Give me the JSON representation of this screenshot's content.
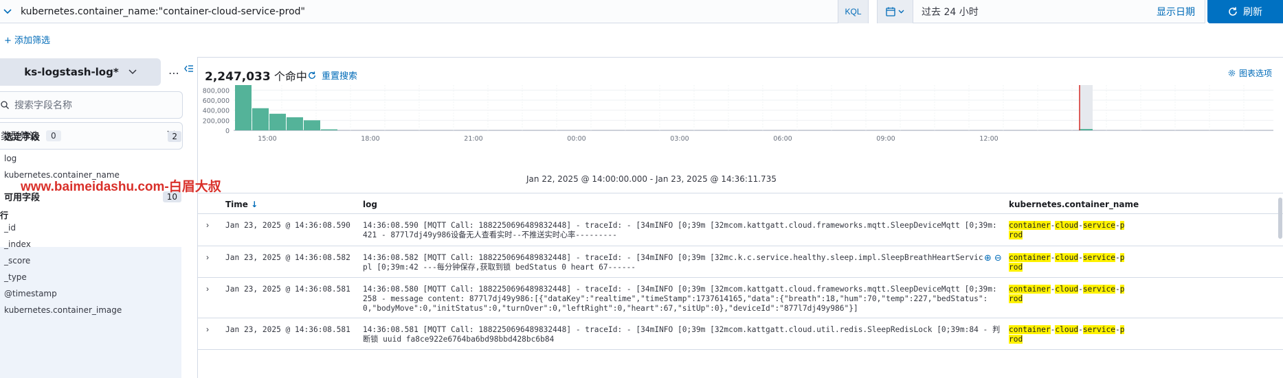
{
  "query": {
    "text": "kubernetes.container_name:\"container-cloud-service-prod\"",
    "language": "KQL"
  },
  "date_picker": {
    "range": "过去 24 小时",
    "show_dates": "显示日期"
  },
  "refresh_label": "刷新",
  "add_filter_label": "+ 添加筛选",
  "sidebar": {
    "index_pattern": "ks-logstash-log*",
    "search_placeholder": "搜索字段名称",
    "type_filter_label": "类型筛选",
    "type_filter_count": "0",
    "selected_fields_title": "选定字段",
    "selected_fields_count": "2",
    "selected_fields": [
      "log",
      "kubernetes.container_name"
    ],
    "available_fields_title": "可用字段",
    "available_fields_count": "10",
    "popular_label": "流行",
    "available_fields": [
      "_id",
      "_index",
      "_score",
      "_type",
      "@timestamp",
      "kubernetes.container_image"
    ]
  },
  "watermark": "www.baimeidashu.com-白眉大叔",
  "main": {
    "hits_count": "2,247,033",
    "hits_suffix": "个命中",
    "reset_search": "重置搜索",
    "chart_options": "图表选项",
    "time_range": "Jan 22, 2025 @ 14:00:00.000 - Jan 23, 2025 @ 14:36:11.735"
  },
  "chart_data": {
    "type": "bar",
    "y_ticks": [
      "800,000",
      "600,000",
      "400,000",
      "200,000",
      "0"
    ],
    "x_ticks": [
      "15:00",
      "18:00",
      "21:00",
      "00:00",
      "03:00",
      "06:00",
      "09:00",
      "12:00"
    ],
    "ylim": [
      0,
      900000
    ],
    "values": [
      980000,
      440000,
      330000,
      260000,
      200000,
      20000
    ],
    "color": "#54b399",
    "end_marker_color": "#d9302a"
  },
  "table": {
    "headers": {
      "time": "Time",
      "log": "log",
      "kube": "kubernetes.container_name"
    },
    "rows": [
      {
        "time": "Jan 23, 2025 @ 14:36:08.590",
        "log": "14:36:08.590 [MQTT Call: 1882250696489832448]  - traceId: -  [34mINFO  [0;39m  [32mcom.kattgatt.cloud.frameworks.mqtt.SleepDeviceMqtt [0;39m:421 - 877l7dj49y986设备无人查看实时--不推送实时心率---------",
        "kube": [
          "container",
          "-",
          "cloud",
          "-",
          "service",
          "-",
          "prod"
        ]
      },
      {
        "time": "Jan 23, 2025 @ 14:36:08.582",
        "log": "14:36:08.582 [MQTT Call: 1882250696489832448]  - traceId: -  [34mINFO  [0;39m  [32mc.k.c.service.healthy.sleep.impl.SleepBreathHeartServiceImpl [0;39m:42 ---每分钟保存,获取到锁 bedStatus 0 heart 67------",
        "kube": [
          "container",
          "-",
          "cloud",
          "-",
          "service",
          "-",
          "prod"
        ]
      },
      {
        "time": "Jan 23, 2025 @ 14:36:08.581",
        "log": "14:36:08.580 [MQTT Call: 1882250696489832448]  - traceId: -  [34mINFO  [0;39m  [32mcom.kattgatt.cloud.frameworks.mqtt.SleepDeviceMqtt [0;39m:258 - message content: 877l7dj49y986:[{\"dataKey\":\"realtime\",\"timeStamp\":1737614165,\"data\":{\"breath\":18,\"hum\":70,\"temp\":227,\"bedStatus\":0,\"bodyMove\":0,\"initStatus\":0,\"turnOver\":0,\"leftRight\":0,\"heart\":67,\"sitUp\":0},\"deviceId\":\"877l7dj49y986\"}]",
        "kube": [
          "container",
          "-",
          "cloud",
          "-",
          "service",
          "-",
          "prod"
        ]
      },
      {
        "time": "Jan 23, 2025 @ 14:36:08.581",
        "log": "14:36:08.581 [MQTT Call: 1882250696489832448]  - traceId: -  [34mINFO  [0;39m  [32mcom.kattgatt.cloud.util.redis.SleepRedisLock [0;39m:84 - 判断锁 uuid fa8ce922e6764ba6bd98bbd428bc6b84",
        "kube": [
          "container",
          "-",
          "cloud",
          "-",
          "service",
          "-",
          "prod"
        ]
      }
    ]
  }
}
